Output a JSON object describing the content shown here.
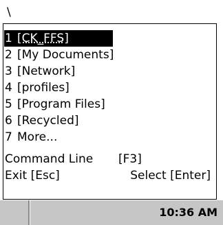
{
  "address_bar": {
    "value": "\\"
  },
  "menu": {
    "items": [
      {
        "num": "1",
        "label": "[CK_FFS]",
        "selected": true
      },
      {
        "num": "2",
        "label": "[My Documents]",
        "selected": false
      },
      {
        "num": "3",
        "label": "[Network]",
        "selected": false
      },
      {
        "num": "4",
        "label": "[profiles]",
        "selected": false
      },
      {
        "num": "5",
        "label": "[Program Files]",
        "selected": false
      },
      {
        "num": "6",
        "label": "[Recycled]",
        "selected": false
      },
      {
        "num": "7",
        "label": "More...",
        "selected": false
      }
    ],
    "command_line": {
      "label": "Command Line",
      "key": "[F3]"
    },
    "exit_label": "Exit [Esc]",
    "select_label": "Select [Enter]"
  },
  "taskbar": {
    "clock": "10:36 AM"
  },
  "colors": {
    "selection_bg": "#000000",
    "selection_fg": "#ffffff",
    "taskbar_bg": "#c6c6c6"
  }
}
